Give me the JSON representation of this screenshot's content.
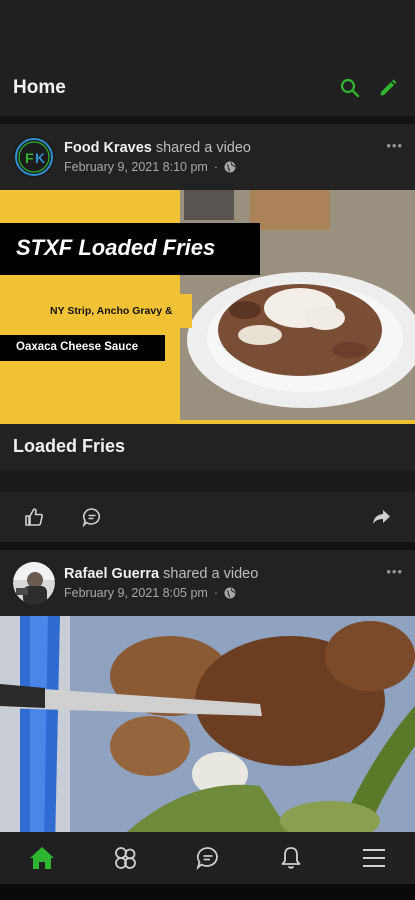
{
  "header": {
    "title": "Home",
    "icons": [
      "search-icon",
      "edit-icon"
    ],
    "accent_color": "#2fb52f"
  },
  "posts": [
    {
      "author": "Food Kraves",
      "action": " shared a video",
      "date": "February 9, 2021 8:10 pm",
      "dot": "·",
      "avatar_text": "FK",
      "more": "•••",
      "video_overlay": {
        "title": "STXF Loaded Fries",
        "line1": "NY Strip, Ancho Gravy &",
        "line2": "Oaxaca Cheese Sauce"
      },
      "caption": "Loaded Fries",
      "actions": [
        "like-icon",
        "comment-icon",
        "share-icon"
      ]
    },
    {
      "author": "Rafael Guerra",
      "action": " shared a video",
      "date": "February 9, 2021 8:05 pm",
      "dot": "·",
      "more": "•••"
    }
  ],
  "bottom_nav": {
    "items": [
      "home-icon",
      "groups-icon",
      "messages-icon",
      "notifications-icon",
      "menu-icon"
    ],
    "active": "home-icon",
    "active_color": "#2fb52f"
  }
}
